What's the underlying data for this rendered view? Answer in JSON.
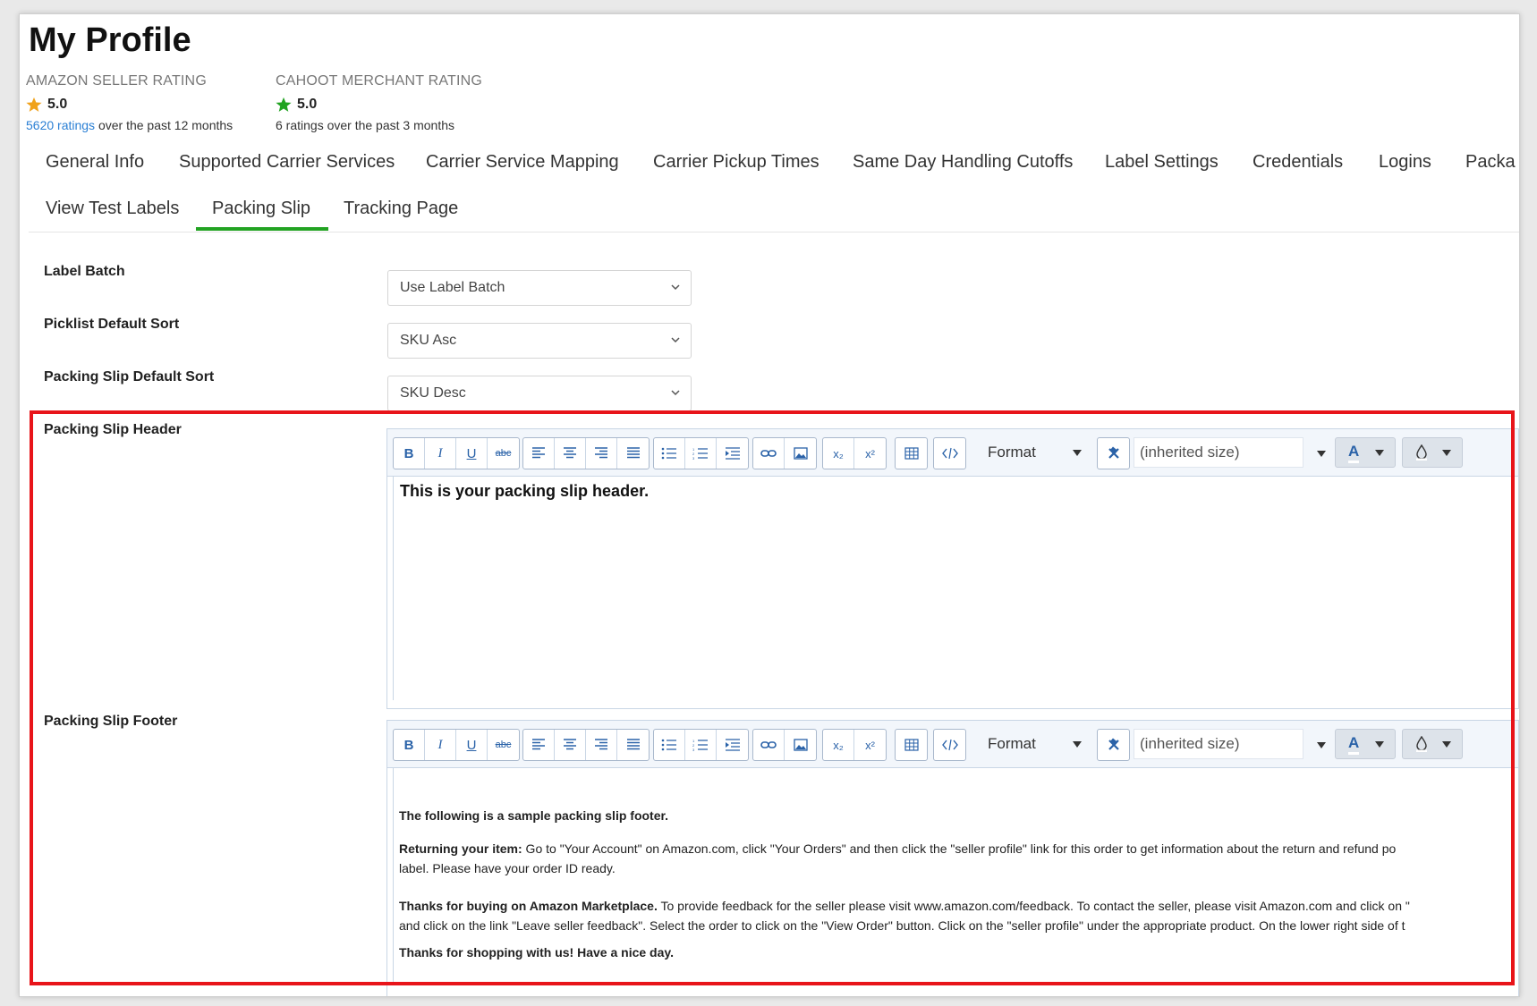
{
  "page_title": "My Profile",
  "ratings": [
    {
      "label": "AMAZON SELLER RATING",
      "value": "5.0",
      "star_color": "#f0a21b",
      "count_link": "5620 ratings",
      "period": " over the past 12 months"
    },
    {
      "label": "CAHOOT MERCHANT RATING",
      "value": "5.0",
      "star_color": "#22a322",
      "count_link": "",
      "period": "6 ratings over the past 3 months"
    }
  ],
  "tabs_row1": [
    "General Info",
    "Supported Carrier Services",
    "Carrier Service Mapping",
    "Carrier Pickup Times",
    "Same Day Handling Cutoffs",
    "Label Settings",
    "Credentials",
    "Logins",
    "Packa"
  ],
  "tabs_row2": [
    "View Test Labels",
    "Packing Slip",
    "Tracking Page"
  ],
  "active_tab": "Packing Slip",
  "accent_color": "#22a322",
  "fields": {
    "label_batch": {
      "label": "Label Batch",
      "value": "Use Label Batch"
    },
    "picklist_sort": {
      "label": "Picklist Default Sort",
      "value": "SKU Asc"
    },
    "packing_sort": {
      "label": "Packing Slip Default Sort",
      "value": "SKU Desc"
    }
  },
  "toolbar": {
    "bold": "B",
    "italic": "I",
    "underline": "U",
    "strike": "abc",
    "format_label": "Format",
    "size_label": "(inherited size)",
    "font_color_label": "A",
    "sub": "x₂",
    "sup": "x²"
  },
  "header_editor": {
    "label": "Packing Slip Header",
    "content": "This is your packing slip header."
  },
  "footer_editor": {
    "label": "Packing Slip Footer",
    "p1": "The following is a sample packing slip footer.",
    "p2_bold": "Returning your item:",
    "p2_text": " Go to \"Your Account\" on Amazon.com, click \"Your Orders\" and then click the \"seller profile\" link for this order to get information about the return and refund po",
    "p2_line2": "label. Please have your order ID ready.",
    "p3_bold": "Thanks for buying on Amazon Marketplace.",
    "p3_text": " To provide feedback for the seller please visit www.amazon.com/feedback. To contact the seller, please visit Amazon.com and click on \"",
    "p3_line2": "and click on the link \"Leave seller feedback\". Select the order to click on the \"View Order\" button. Click on the \"seller profile\" under the appropriate product. On the lower right side of t",
    "p4": "Thanks for shopping with us! Have a nice day."
  },
  "highlight_color": "#e8141a"
}
